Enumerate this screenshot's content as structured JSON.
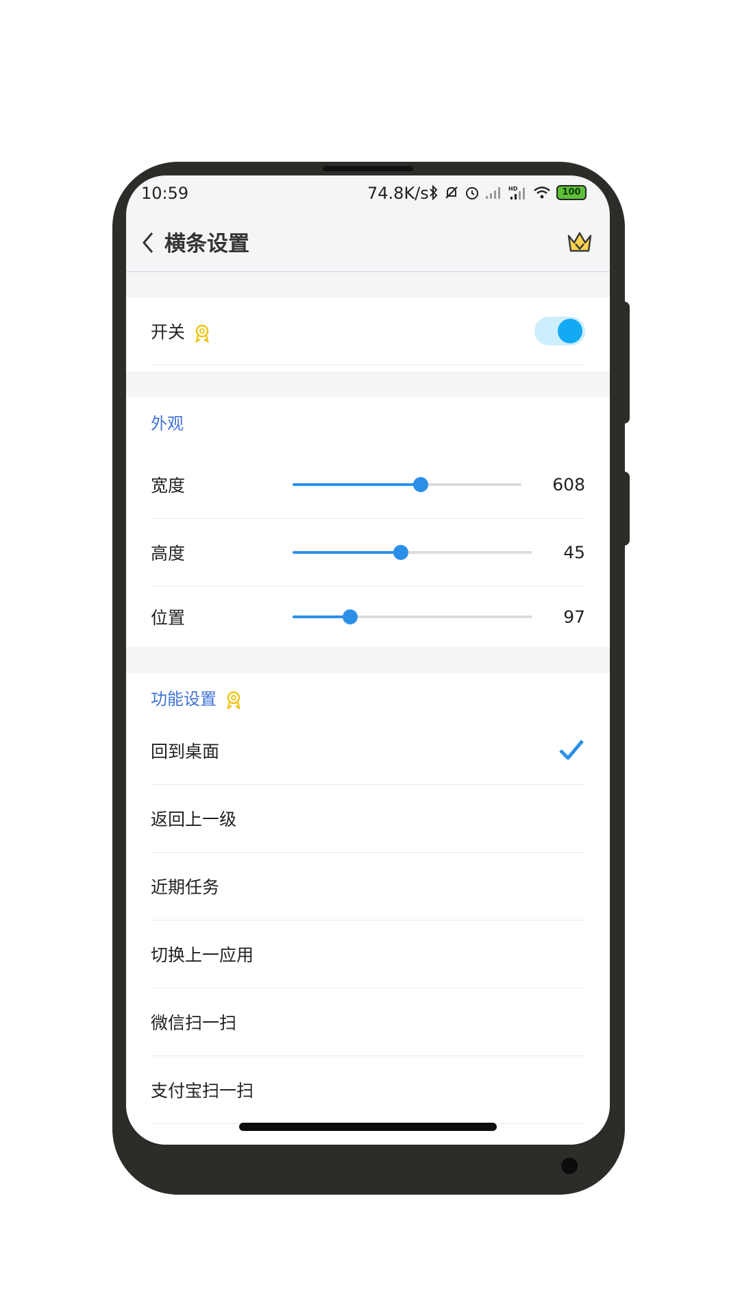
{
  "status": {
    "time": "10:59",
    "speed": "74.8K/s",
    "battery": "100",
    "icons": [
      "bluetooth-icon",
      "mute-icon",
      "alarm-icon",
      "signal-icon",
      "hd-signal-icon",
      "wifi-icon"
    ]
  },
  "header": {
    "title": "横条设置",
    "back_icon": "chevron-left-icon",
    "vip_icon": "crown-icon"
  },
  "switch": {
    "label": "开关",
    "on": true
  },
  "appearance": {
    "title": "外观",
    "sliders": [
      {
        "label": "宽度",
        "value": "608",
        "fraction": 0.56
      },
      {
        "label": "高度",
        "value": "45",
        "fraction": 0.45
      },
      {
        "label": "位置",
        "value": "97",
        "fraction": 0.24
      }
    ]
  },
  "functions": {
    "title": "功能设置",
    "items": [
      {
        "label": "回到桌面",
        "checked": true
      },
      {
        "label": "返回上一级",
        "checked": false
      },
      {
        "label": "近期任务",
        "checked": false
      },
      {
        "label": "切换上一应用",
        "checked": false
      },
      {
        "label": "微信扫一扫",
        "checked": false
      },
      {
        "label": "支付宝扫一扫",
        "checked": false
      }
    ]
  },
  "colors": {
    "accent": "#2b8fe8",
    "section_title": "#3f72d8",
    "toggle_on": "#13aaf3",
    "badge": "#f0c419"
  }
}
